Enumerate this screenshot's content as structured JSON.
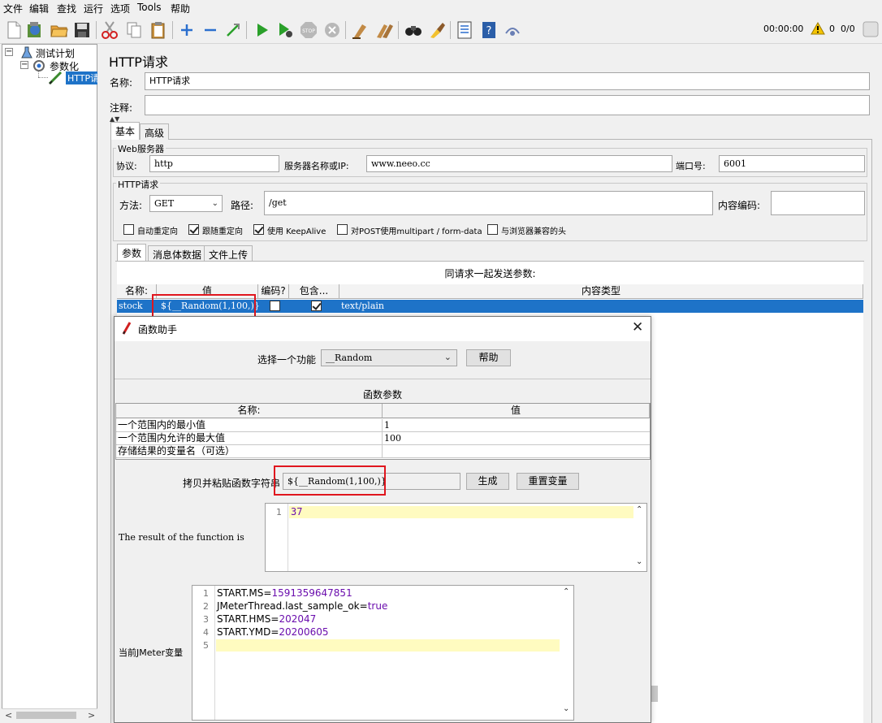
{
  "menu": [
    "文件",
    "编辑",
    "查找",
    "运行",
    "选项",
    "Tools",
    "帮助"
  ],
  "status": {
    "timer": "00:00:00",
    "warnings": "0",
    "threads": "0/0"
  },
  "tree": {
    "root": "测试计划",
    "child": "参数化",
    "leaf": "HTTP请求"
  },
  "panel": {
    "title": "HTTP请求",
    "name_label": "名称:",
    "name_value": "HTTP请求",
    "comment_label": "注释:",
    "comment_value": "",
    "tabs": [
      "基本",
      "高级"
    ],
    "web_server": {
      "title": "Web服务器",
      "protocol_label": "协议:",
      "protocol_value": "http",
      "server_label": "服务器名称或IP:",
      "server_value": "www.neeo.cc",
      "port_label": "端口号:",
      "port_value": "6001"
    },
    "http_request": {
      "title": "HTTP请求",
      "method_label": "方法:",
      "method_value": "GET",
      "path_label": "路径:",
      "path_value": "/get",
      "encoding_label": "内容编码:",
      "encoding_value": "",
      "checkboxes": [
        {
          "label": "自动重定向",
          "checked": false
        },
        {
          "label": "跟随重定向",
          "checked": true
        },
        {
          "label": "使用 KeepAlive",
          "checked": true
        },
        {
          "label": "对POST使用multipart / form-data",
          "checked": false
        },
        {
          "label": "与浏览器兼容的头",
          "checked": false
        }
      ]
    },
    "param_tabs": [
      "参数",
      "消息体数据",
      "文件上传"
    ],
    "params_header": "同请求一起发送参数:",
    "columns": [
      "名称:",
      "值",
      "编码?",
      "包含...",
      "内容类型"
    ],
    "rows": [
      {
        "name": "stock",
        "value": "${__Random(1,100,)}",
        "encode": false,
        "include": true,
        "content_type": "text/plain"
      }
    ]
  },
  "dialog": {
    "title": "函数助手",
    "select_label": "选择一个功能",
    "select_value": "__Random",
    "help_button": "帮助",
    "params_title": "函数参数",
    "columns": [
      "名称:",
      "值"
    ],
    "rows": [
      {
        "name": "一个范围内的最小值",
        "value": "1"
      },
      {
        "name": "一个范围内允许的最大值",
        "value": "100"
      },
      {
        "name": "存储结果的变量名（可选）",
        "value": ""
      }
    ],
    "copy_label": "拷贝并粘贴函数字符串",
    "function_string": "${__Random(1,100,)}",
    "generate_button": "生成",
    "reset_button": "重置变量",
    "result_label": "The result of the function is",
    "result_lines": [
      "37"
    ],
    "vars_label": "当前JMeter变量",
    "vars": [
      {
        "key": "START.MS",
        "value": "1591359647851"
      },
      {
        "key": "JMeterThread.last_sample_ok",
        "value": "true"
      },
      {
        "key": "START.HMS",
        "value": "202047"
      },
      {
        "key": "START.YMD",
        "value": "20200605"
      }
    ],
    "line_numbers": [
      "1",
      "2",
      "3",
      "4",
      "5"
    ]
  },
  "colors": {
    "selection": "#1e73c8",
    "highlight_line": "#fffbc0",
    "value_purple": "#6a0dad",
    "red_box": "#e0161e"
  }
}
